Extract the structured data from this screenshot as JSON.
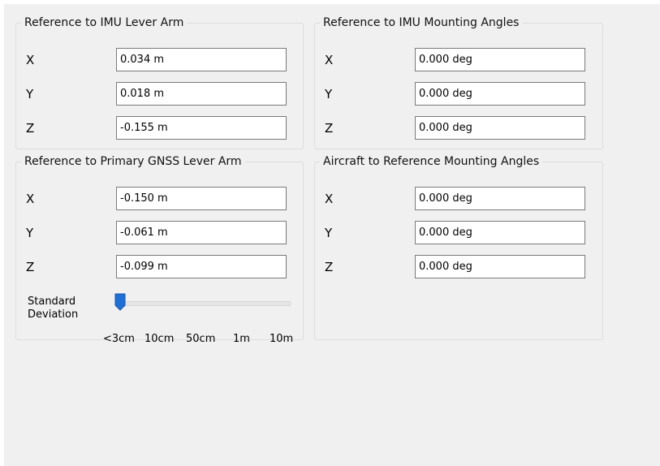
{
  "groups": {
    "imu_lever_arm": {
      "title": "Reference to IMU Lever Arm",
      "rows": [
        {
          "axis": "X",
          "value": "0.034 m"
        },
        {
          "axis": "Y",
          "value": "0.018 m"
        },
        {
          "axis": "Z",
          "value": "-0.155 m"
        }
      ]
    },
    "imu_mounting": {
      "title": "Reference to IMU Mounting Angles",
      "rows": [
        {
          "axis": "X",
          "value": "0.000 deg"
        },
        {
          "axis": "Y",
          "value": "0.000 deg"
        },
        {
          "axis": "Z",
          "value": "0.000 deg"
        }
      ]
    },
    "gnss_lever_arm": {
      "title": "Reference to Primary GNSS Lever Arm",
      "rows": [
        {
          "axis": "X",
          "value": "-0.150 m"
        },
        {
          "axis": "Y",
          "value": "-0.061 m"
        },
        {
          "axis": "Z",
          "value": "-0.099 m"
        }
      ],
      "std_dev": {
        "label_line1": "Standard",
        "label_line2": "Deviation",
        "ticks": [
          "<3cm",
          "10cm",
          "50cm",
          "1m",
          "10m"
        ],
        "selected_index": 0,
        "accent": "#1e6fd6"
      }
    },
    "aircraft_mounting": {
      "title": "Aircraft to Reference Mounting Angles",
      "rows": [
        {
          "axis": "X",
          "value": "0.000 deg"
        },
        {
          "axis": "Y",
          "value": "0.000 deg"
        },
        {
          "axis": "Z",
          "value": "0.000 deg"
        }
      ]
    }
  }
}
